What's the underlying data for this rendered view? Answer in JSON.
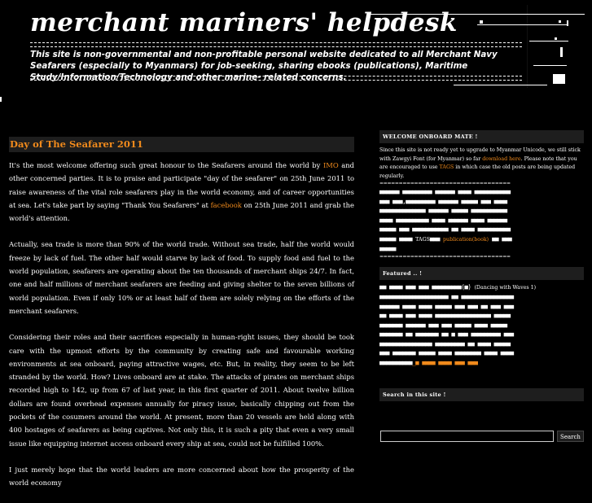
{
  "header": {
    "title": "merchant mariners' helpdesk",
    "description": "This site is non-governmental and non-profitable personal website dedicated to all Merchant Navy Seafarers (especially to Myanmars) for job-seeking, sharing ebooks (publications), Maritime Study/Information/Technology and other marine- related concerns."
  },
  "post": {
    "title": "Day of The Seafarer 2011",
    "p1_a": "It's the most welcome offering such great honour to the Seafarers around the world by ",
    "p1_link1": "IMO",
    "p1_b": " and other concerned parties. It is to praise and participate \"day of the seafarer\" on 25th June 2011 to raise awareness of the vital role seafarers play in the world economy, and of career opportunities at sea. Let's take part by saying \"Thank You Seafarers\" at ",
    "p1_link2": "facebook",
    "p1_c": " on 25th June 2011 and grab the world's attention.",
    "p2": "Actually, sea trade is more than 90% of the world trade. Without sea trade, half the world would freeze by lack of fuel. The other half would starve by lack of food. To supply food and fuel to the world population, seafarers are operating about the ten thousands of merchant ships 24/7. In fact, one and half millions of merchant seafarers are feeding and giving shelter to the seven billions of world population. Even if only 10% or at least half of them are solely relying on the efforts of the merchant seafarers.",
    "p3": "Considering their roles and their sacrifices especially in human-right issues, they should be took care with the upmost efforts by the community by creating safe and favourable working environments at sea onboard, paying attractive wages, etc. But, in reality, they seem to be left stranded by the world. How? Lives onboard are at stake. The attacks of pirates on merchant ships recorded high to 142, up from 67 of last year, in this first quarter of 2011. About twelve billion dollars are found overhead expenses annually for piracy issue, basically chipping out from the pockets of the cosumers around the world. At present, more than 20 vessels are held along with 400 hostages of seafarers as being captives. Not only this, it is such a pity that even a very small issue like equipping internet access onboard every ship at sea, could not be fulfilled 100%.",
    "p4": "I just merely hope that the world leaders are more concerned about how the prosperity of the world economy"
  },
  "sidebar": {
    "welcome_title": "WELCOME ONBOARD MATE !",
    "welcome_a": "Since this site is not ready yet to upgrade to Myanmar Unicode, we still stick with Zawgyi Font (for Myanmar) so far ",
    "welcome_link1": "download here",
    "welcome_b": ". Please note that you are encouraged to use ",
    "welcome_link2": "TAGS",
    "welcome_c": " in which case the old posts are being updated regularly.",
    "tags_label": "TAGS",
    "publication_link": "publication(book)",
    "featured_title": "Featured .. !",
    "featured_text": "(Dancing with Waves 1)",
    "search_title": "Search in this site !",
    "search_button": "Search"
  },
  "colors": {
    "accent": "#f08a1c",
    "bar": "#1e1e1e",
    "background": "#000000"
  }
}
